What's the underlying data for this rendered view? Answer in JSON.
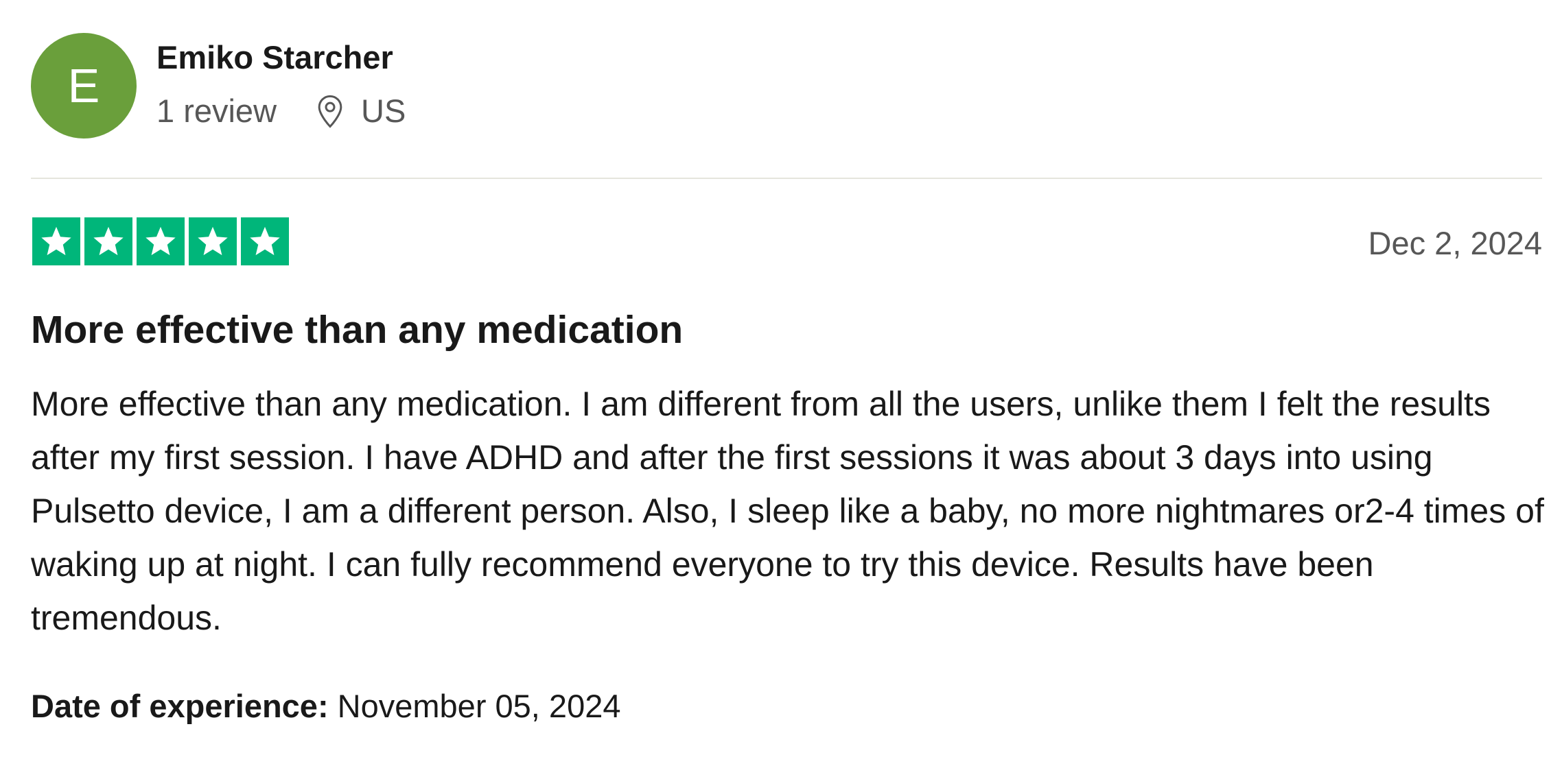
{
  "reviewer": {
    "avatar_initial": "E",
    "avatar_color": "#6a9f3b",
    "name": "Emiko Starcher",
    "review_count": "1 review",
    "location_icon": "location-pin-icon",
    "country": "US"
  },
  "review": {
    "rating": 5,
    "rating_max": 5,
    "star_color": "#00b67a",
    "date": "Dec 2, 2024",
    "title": "More effective than any medication",
    "body": "More effective than any medication. I am different from all the users, unlike them I felt the results after my first session. I have ADHD and after the first sessions it was about 3 days into using Pulsetto device, I am a different person. Also, I sleep like a baby, no more nightmares or2-4 times of waking up at night. I can fully recommend everyone to try this device. Results have been tremendous.",
    "experience_label": "Date of experience:",
    "experience_date": "November 05, 2024"
  }
}
